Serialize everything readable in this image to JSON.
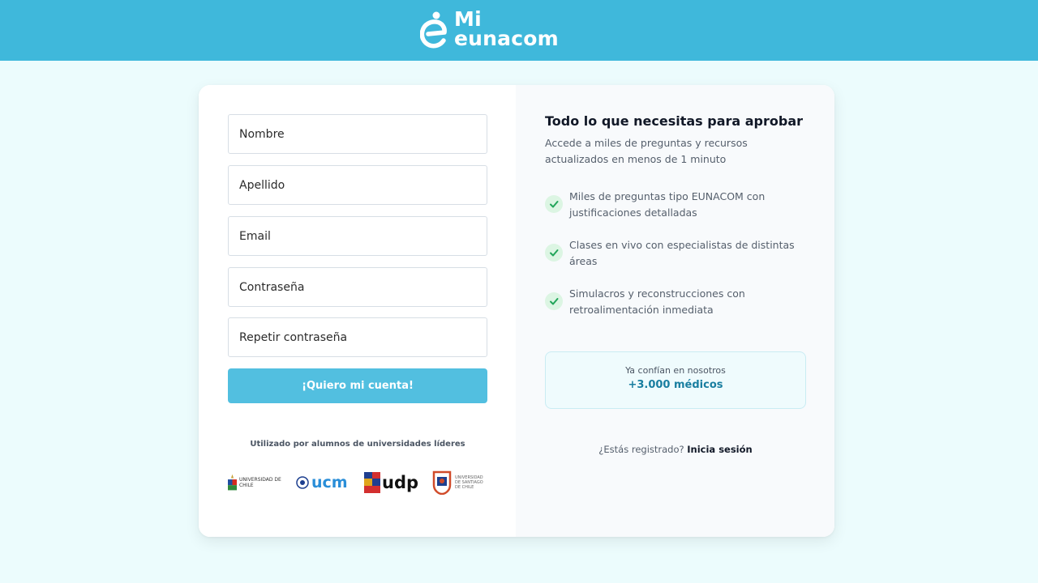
{
  "brand": {
    "line1": "Mi",
    "line2": "eunacom",
    "header_color": "#3fb8db"
  },
  "form": {
    "fields": [
      {
        "name": "first-name-field",
        "placeholder": "Nombre"
      },
      {
        "name": "last-name-field",
        "placeholder": "Apellido"
      },
      {
        "name": "email-field",
        "placeholder": "Email"
      },
      {
        "name": "password-field",
        "placeholder": "Contraseña"
      },
      {
        "name": "repeat-password-field",
        "placeholder": "Repetir contraseña"
      }
    ],
    "submit_label": "¡Quiero mi cuenta!",
    "submit_color": "#52bfe0"
  },
  "universities": {
    "heading": "Utilizado por alumnos de universidades líderes",
    "logos": [
      {
        "icon": "universidad-de-chile-logo",
        "label": "UNIVERSIDAD DE CHILE"
      },
      {
        "icon": "ucm-logo",
        "label": "ucm"
      },
      {
        "icon": "udp-logo",
        "label": "udp"
      },
      {
        "icon": "usach-logo",
        "label": "UNIVERSIDAD DE SANTIAGO DE CHILE"
      }
    ]
  },
  "promo": {
    "title": "Todo lo que necesitas para aprobar",
    "subtitle": "Accede a miles de preguntas y recursos actualizados en menos de 1 minuto",
    "features": [
      "Miles de preguntas tipo EUNACOM con justificaciones detalladas",
      "Clases en vivo con especialistas de distintas áreas",
      "Simulacros y reconstrucciones con retroalimentación inmediata"
    ],
    "check_color": "#22a55a",
    "trust": {
      "line1": "Ya confían en nosotros",
      "line2": "+3.000 médicos"
    },
    "login_prompt": "¿Estás registrado?",
    "login_link": "Inicia sesión"
  }
}
